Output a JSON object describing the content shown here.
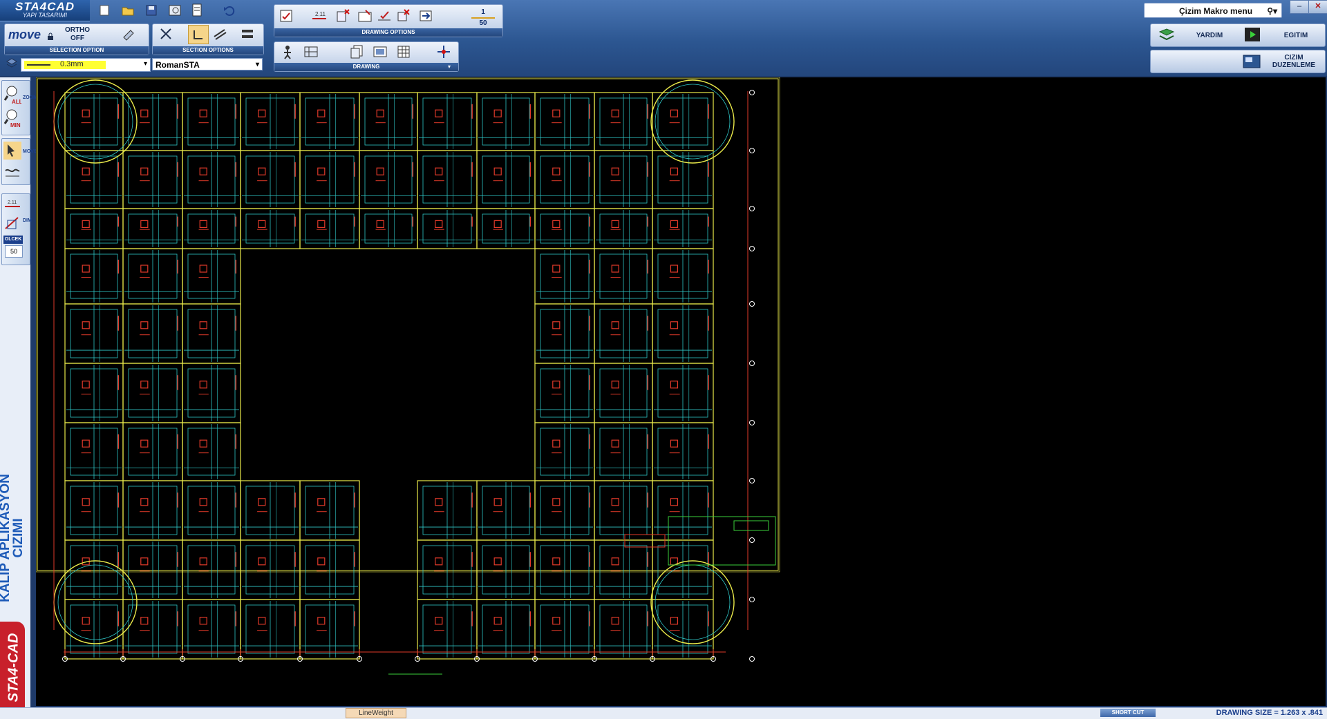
{
  "app": {
    "title": "STA4CAD",
    "subtitle": "YAPI TASARIMI"
  },
  "selection": {
    "move_label": "move",
    "ortho_line1": "ORTHO",
    "ortho_line2": "OFF",
    "caption": "SELECTION OPTION"
  },
  "section": {
    "caption": "SECTION OPTIONS"
  },
  "drawing_options": {
    "caption": "DRAWING OPTIONS",
    "scale_top": "1",
    "scale_bottom": "50"
  },
  "drawing": {
    "caption": "DRAWING"
  },
  "lineweight": {
    "value": "0.3mm"
  },
  "font": {
    "value": "RomanSTA"
  },
  "macro": {
    "label": "Çizim Makro menu"
  },
  "buttons": {
    "yardim": "YARDIM",
    "egitim": "EGITIM",
    "cizim_line1": "CIZIM",
    "cizim_line2": "DUZENLEME"
  },
  "left_toolbar": {
    "zoom_caption": "ZOOM",
    "move_caption": "MOVE",
    "dim_caption": "DIM",
    "olcek_label": "OLCEK",
    "olcek_value": "50",
    "all_label": "ALL",
    "min_label": "MIN"
  },
  "side_title": {
    "line1": "KALIP APLIKASYON",
    "line2": "CIZIMI"
  },
  "brand": "STA4-CAD",
  "status": {
    "lineweight_tab": "LineWeight",
    "shortcut": "SHORT CUT",
    "drawing_size": "DRAWING SIZE = 1.263 x .841"
  },
  "colors": {
    "grid": "#2fc6c6",
    "beam": "#e8e84a",
    "rebar": "#e23a2a",
    "highlight": "#3ad03a",
    "canvas": "#000000"
  }
}
